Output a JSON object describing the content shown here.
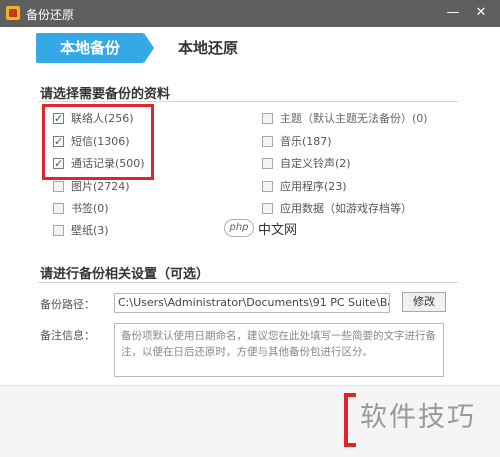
{
  "window": {
    "title": "备份还原",
    "min_glyph": "—",
    "close_glyph": "✕"
  },
  "tabs": [
    {
      "label": "本地备份",
      "active": true
    },
    {
      "label": "本地还原",
      "active": false
    }
  ],
  "select_section": {
    "title": "请选择需要备份的资料",
    "left_options": [
      {
        "label": "联络人(256)",
        "checked": true
      },
      {
        "label": "短信(1306)",
        "checked": true
      },
      {
        "label": "通话记录(500)",
        "checked": true
      },
      {
        "label": "图片(2724)",
        "checked": false
      },
      {
        "label": "书签(0)",
        "checked": false
      },
      {
        "label": "壁纸(3)",
        "checked": false
      }
    ],
    "right_options": [
      {
        "label": "主题（默认主题无法备份）(0)",
        "checked": false
      },
      {
        "label": "音乐(187)",
        "checked": false
      },
      {
        "label": "自定义铃声(2)",
        "checked": false
      },
      {
        "label": "应用程序(23)",
        "checked": false
      },
      {
        "label": "应用数据（如游戏存档等）",
        "checked": false
      }
    ]
  },
  "settings_section": {
    "title": "请进行备份相关设置（可选）",
    "path_label": "备份路径：",
    "path_value": "C:\\Users\\Administrator\\Documents\\91 PC Suite\\Ba",
    "modify_label": "修改",
    "note_label": "备注信息：",
    "note_placeholder": "备份项默认使用日期命名，建议您在此处填写一些简要的文字进行备注，以便在日后还原时，方便与其他备份包进行区分。"
  },
  "watermark": {
    "logo_text": "php",
    "site_text": "中文网"
  },
  "corner_caption": "软件技巧",
  "colors": {
    "titlebar": "#5e5e5e",
    "accent_tab": "#35a9e6",
    "highlight_red": "#e0242b"
  }
}
